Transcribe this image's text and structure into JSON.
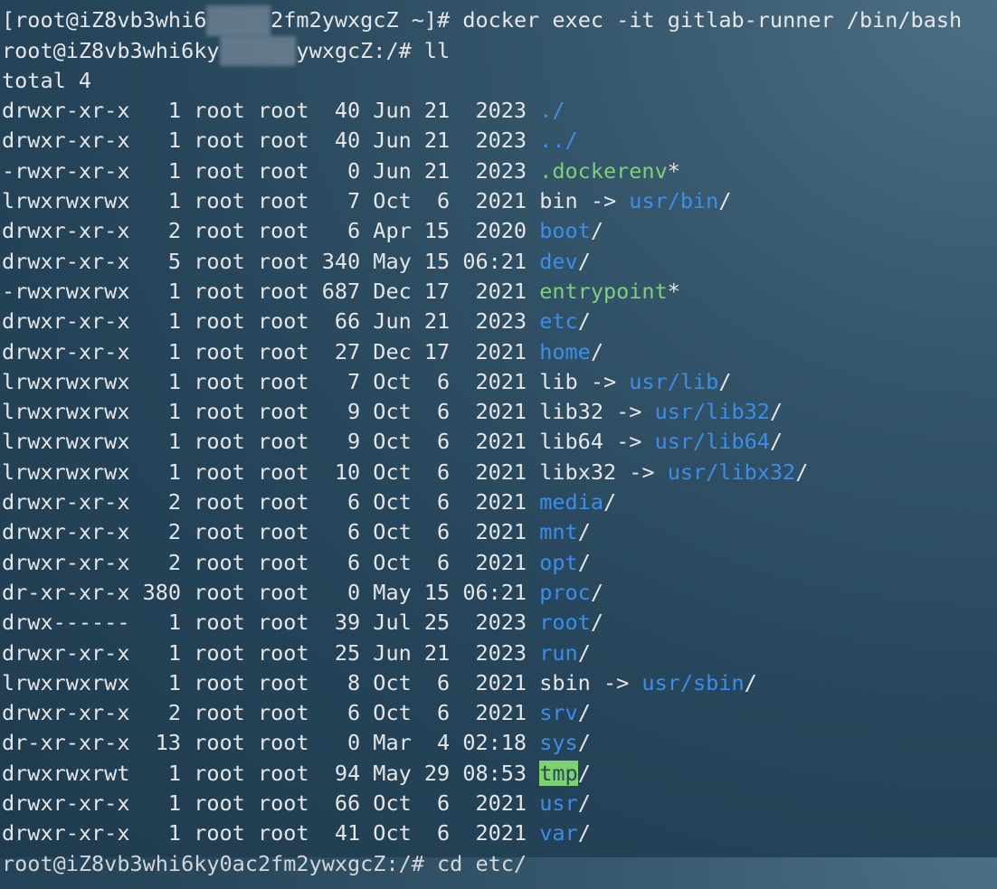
{
  "terminal": {
    "partial_top": "root",
    "prompt1_prefix": "[root@iZ8vb3whi6",
    "prompt1_blur": "ky0ac",
    "prompt1_mid": "2fm2ywxgcZ ~]# ",
    "command1": "docker exec -it gitlab-runner /bin/bash",
    "prompt2_prefix": "root@iZ8vb3whi6ky",
    "prompt2_blur": "0ac2fm",
    "prompt2_suffix": "ywxgcZ:/# ",
    "command2": "ll",
    "total_line": "total 4",
    "entries": [
      {
        "meta": "drwxr-xr-x   1 root root  40 Jun 21  2023 ",
        "name": "./",
        "type": "dir"
      },
      {
        "meta": "drwxr-xr-x   1 root root  40 Jun 21  2023 ",
        "name": "../",
        "type": "dir"
      },
      {
        "meta": "-rwxr-xr-x   1 root root   0 Jun 21  2023 ",
        "name": ".dockerenv",
        "suffix": "*",
        "type": "exec"
      },
      {
        "meta": "lrwxrwxrwx   1 root root   7 Oct  6  2021 ",
        "name": "bin",
        "arrow": " -> ",
        "target": "usr/bin",
        "suffix": "/",
        "type": "link"
      },
      {
        "meta": "drwxr-xr-x   2 root root   6 Apr 15  2020 ",
        "name": "boot",
        "suffix": "/",
        "type": "dir"
      },
      {
        "meta": "drwxr-xr-x   5 root root 340 May 15 06:21 ",
        "name": "dev",
        "suffix": "/",
        "type": "dir"
      },
      {
        "meta": "-rwxrwxrwx   1 root root 687 Dec 17  2021 ",
        "name": "entrypoint",
        "suffix": "*",
        "type": "exec"
      },
      {
        "meta": "drwxr-xr-x   1 root root  66 Jun 21  2023 ",
        "name": "etc",
        "suffix": "/",
        "type": "dir"
      },
      {
        "meta": "drwxr-xr-x   1 root root  27 Dec 17  2021 ",
        "name": "home",
        "suffix": "/",
        "type": "dir"
      },
      {
        "meta": "lrwxrwxrwx   1 root root   7 Oct  6  2021 ",
        "name": "lib",
        "arrow": " -> ",
        "target": "usr/lib",
        "suffix": "/",
        "type": "link"
      },
      {
        "meta": "lrwxrwxrwx   1 root root   9 Oct  6  2021 ",
        "name": "lib32",
        "arrow": " -> ",
        "target": "usr/lib32",
        "suffix": "/",
        "type": "link"
      },
      {
        "meta": "lrwxrwxrwx   1 root root   9 Oct  6  2021 ",
        "name": "lib64",
        "arrow": " -> ",
        "target": "usr/lib64",
        "suffix": "/",
        "type": "link"
      },
      {
        "meta": "lrwxrwxrwx   1 root root  10 Oct  6  2021 ",
        "name": "libx32",
        "arrow": " -> ",
        "target": "usr/libx32",
        "suffix": "/",
        "type": "link"
      },
      {
        "meta": "drwxr-xr-x   2 root root   6 Oct  6  2021 ",
        "name": "media",
        "suffix": "/",
        "type": "dir"
      },
      {
        "meta": "drwxr-xr-x   2 root root   6 Oct  6  2021 ",
        "name": "mnt",
        "suffix": "/",
        "type": "dir"
      },
      {
        "meta": "drwxr-xr-x   2 root root   6 Oct  6  2021 ",
        "name": "opt",
        "suffix": "/",
        "type": "dir"
      },
      {
        "meta": "dr-xr-xr-x 380 root root   0 May 15 06:21 ",
        "name": "proc",
        "suffix": "/",
        "type": "dir"
      },
      {
        "meta": "drwx------   1 root root  39 Jul 25  2023 ",
        "name": "root",
        "suffix": "/",
        "type": "dir"
      },
      {
        "meta": "drwxr-xr-x   1 root root  25 Jun 21  2023 ",
        "name": "run",
        "suffix": "/",
        "type": "dir"
      },
      {
        "meta": "lrwxrwxrwx   1 root root   8 Oct  6  2021 ",
        "name": "sbin",
        "arrow": " -> ",
        "target": "usr/sbin",
        "suffix": "/",
        "type": "link"
      },
      {
        "meta": "drwxr-xr-x   2 root root   6 Oct  6  2021 ",
        "name": "srv",
        "suffix": "/",
        "type": "dir"
      },
      {
        "meta": "dr-xr-xr-x  13 root root   0 Mar  4 02:18 ",
        "name": "sys",
        "suffix": "/",
        "type": "dir"
      },
      {
        "meta": "drwxrwxrwt   1 root root  94 May 29 08:53 ",
        "name": "tmp",
        "suffix": "/",
        "type": "sticky"
      },
      {
        "meta": "drwxr-xr-x   1 root root  66 Oct  6  2021 ",
        "name": "usr",
        "suffix": "/",
        "type": "dir"
      },
      {
        "meta": "drwxr-xr-x   1 root root  41 Oct  6  2021 ",
        "name": "var",
        "suffix": "/",
        "type": "dir"
      }
    ],
    "partial_bottom": "root@iZ8vb3whi6ky0ac2fm2ywxgcZ:/# cd etc/"
  },
  "colors": {
    "directory": "#3b8eea",
    "executable": "#7ed07c",
    "sticky_bg": "#7bd26e",
    "text": "#e6e6e6"
  }
}
